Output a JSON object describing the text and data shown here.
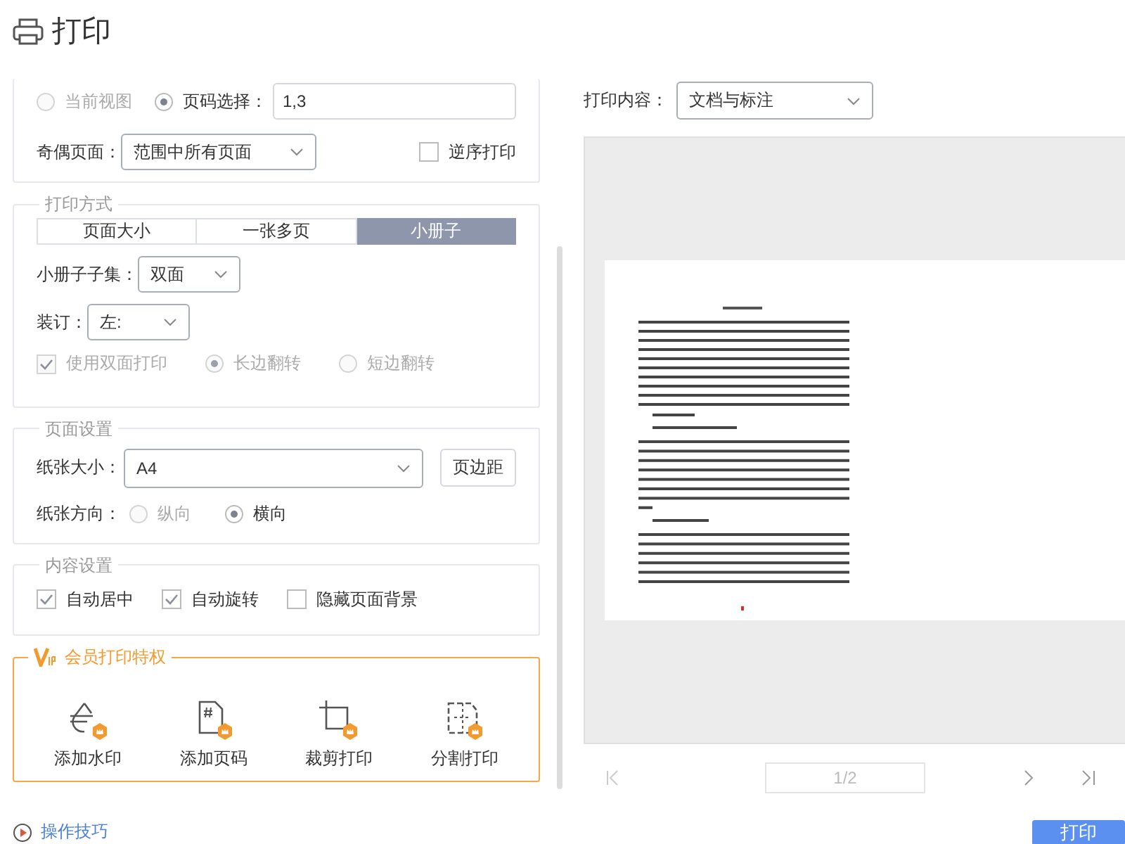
{
  "title": "打印",
  "range": {
    "options": [
      {
        "label": "当前视图",
        "selected": false,
        "disabled": true
      },
      {
        "label": "页码选择：",
        "selected": true,
        "disabled": false
      }
    ],
    "pages_value": "1,3",
    "odd_even_label": "奇偶页面：",
    "odd_even_value": "范围中所有页面",
    "reverse": {
      "label": "逆序打印",
      "checked": false
    }
  },
  "print_mode": {
    "legend": "打印方式",
    "tabs": [
      {
        "label": "页面大小",
        "selected": false
      },
      {
        "label": "一张多页",
        "selected": false
      },
      {
        "label": "小册子",
        "selected": true
      }
    ],
    "subset_label": "小册子子集：",
    "subset_value": "双面",
    "binding_label": "装订：",
    "binding_value": "左:",
    "duplex": {
      "label": "使用双面打印",
      "checked": true,
      "disabled": true
    },
    "flip": [
      {
        "label": "长边翻转",
        "selected": true,
        "disabled": true
      },
      {
        "label": "短边翻转",
        "selected": false,
        "disabled": true
      }
    ]
  },
  "page_setup": {
    "legend": "页面设置",
    "paper_label": "纸张大小：",
    "paper_value": "A4",
    "margins_button": "页边距",
    "orientation_label": "纸张方向：",
    "orientation": [
      {
        "label": "纵向",
        "selected": false,
        "disabled": true
      },
      {
        "label": "横向",
        "selected": true,
        "disabled": false
      }
    ]
  },
  "content": {
    "legend": "内容设置",
    "options": [
      {
        "label": "自动居中",
        "checked": true
      },
      {
        "label": "自动旋转",
        "checked": true
      },
      {
        "label": "隐藏页面背景",
        "checked": false
      }
    ]
  },
  "vip": {
    "legend": "会员打印特权",
    "items": [
      {
        "label": "添加水印",
        "kind": "watermark"
      },
      {
        "label": "添加页码",
        "kind": "page_number"
      },
      {
        "label": "裁剪打印",
        "kind": "crop"
      },
      {
        "label": "分割打印",
        "kind": "split"
      }
    ]
  },
  "tips_link": "操作技巧",
  "print_content": {
    "label": "打印内容：",
    "value": "文档与标注"
  },
  "pager": {
    "value": "1/2"
  },
  "print_button": "打印"
}
